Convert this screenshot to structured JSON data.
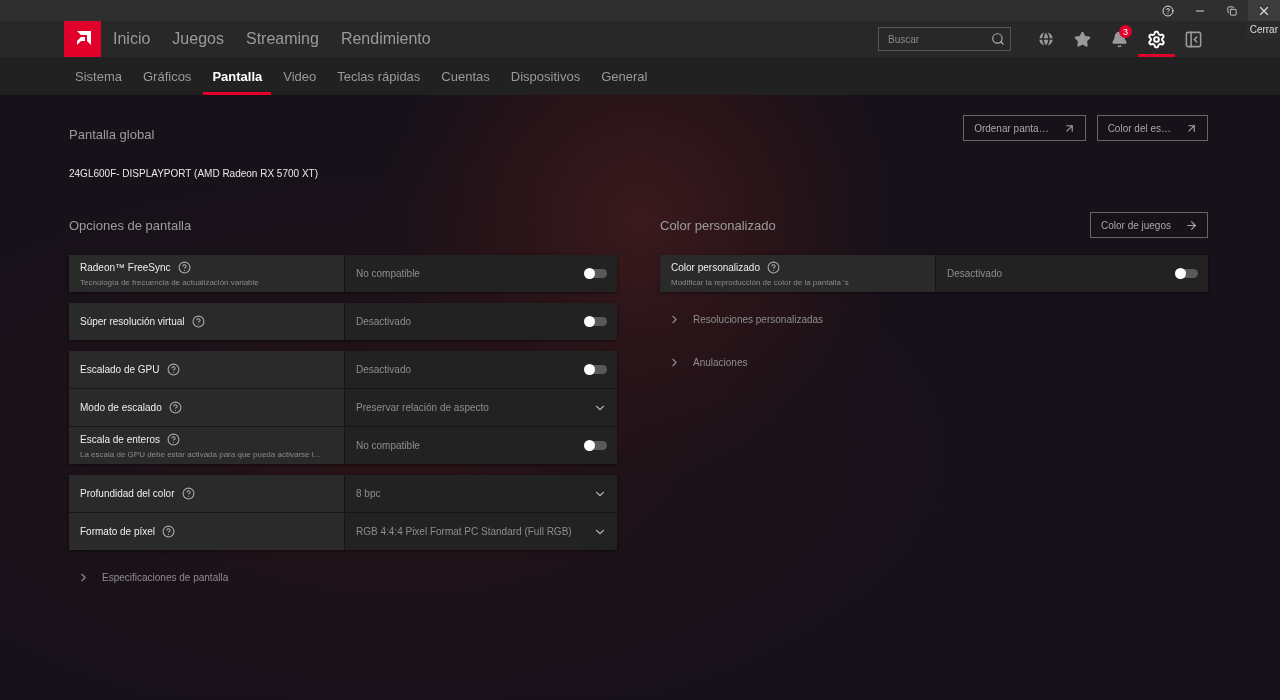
{
  "title_bar": {
    "controls": [
      {
        "kind": "help"
      },
      {
        "kind": "minimize"
      },
      {
        "kind": "restore"
      },
      {
        "kind": "close"
      }
    ],
    "tooltip": "Cerrar"
  },
  "top_nav": {
    "items": [
      "Inicio",
      "Juegos",
      "Streaming",
      "Rendimiento"
    ],
    "search": {
      "placeholder": "Buscar"
    },
    "icons": [
      {
        "kind": "globe",
        "selected": false
      },
      {
        "kind": "star",
        "selected": false
      },
      {
        "kind": "bell",
        "selected": false,
        "badge": "3"
      },
      {
        "kind": "gear",
        "selected": true
      },
      {
        "kind": "panel",
        "selected": false
      }
    ]
  },
  "tabs": [
    {
      "label": "Sistema",
      "selected": false
    },
    {
      "label": "Gráficos",
      "selected": false
    },
    {
      "label": "Pantalla",
      "selected": true
    },
    {
      "label": "Video",
      "selected": false
    },
    {
      "label": "Teclas rápidas",
      "selected": false
    },
    {
      "label": "Cuentas",
      "selected": false
    },
    {
      "label": "Dispositivos",
      "selected": false
    },
    {
      "label": "General",
      "selected": false
    }
  ],
  "global": {
    "heading": "Pantalla global",
    "display": "24GL600F- DISPLAYPORT (AMD Radeon RX 5700 XT)",
    "buttons": [
      "Ordenar panta…",
      "Color del es…"
    ]
  },
  "display_options": {
    "heading": "Opciones de pantalla",
    "groups": [
      [
        {
          "label": "Radeon™ FreeSync",
          "description": "Tecnología de frecuencia de actualización variable",
          "value": "No compatible",
          "kind": "toggle",
          "on": false
        }
      ],
      [
        {
          "label": "Súper resolución virtual",
          "value": "Desactivado",
          "kind": "toggle",
          "on": false
        }
      ],
      [
        {
          "label": "Escalado de GPU",
          "value": "Desactivado",
          "kind": "toggle",
          "on": false
        },
        {
          "label": "Modo de escalado",
          "value": "Preservar relación de aspecto",
          "kind": "dropdown"
        },
        {
          "label": "Escala de enteros",
          "description": "La escala de GPU debe estar activada para que pueda activarse l...",
          "value": "No compatible",
          "kind": "toggle",
          "on": false
        }
      ],
      [
        {
          "label": "Profundidad del color",
          "value": "8 bpc",
          "kind": "dropdown"
        },
        {
          "label": "Formato de píxel",
          "value": "RGB 4:4:4 Pixel Format PC Standard (Full RGB)",
          "kind": "dropdown"
        }
      ]
    ],
    "expanders": [
      {
        "label": "Especificaciones de pantalla",
        "expanded": false
      }
    ]
  },
  "custom_color": {
    "heading": "Color personalizado",
    "button": "Color de juegos",
    "groups": [
      [
        {
          "label": "Color personalizado",
          "description": "Modificar la reproducción de color de la pantalla 's",
          "value": "Desactivado",
          "kind": "toggle",
          "on": false
        }
      ]
    ],
    "expanders": [
      {
        "label": "Resoluciones personalizadas",
        "expanded": false
      },
      {
        "label": "Anulaciones",
        "expanded": false
      }
    ]
  }
}
